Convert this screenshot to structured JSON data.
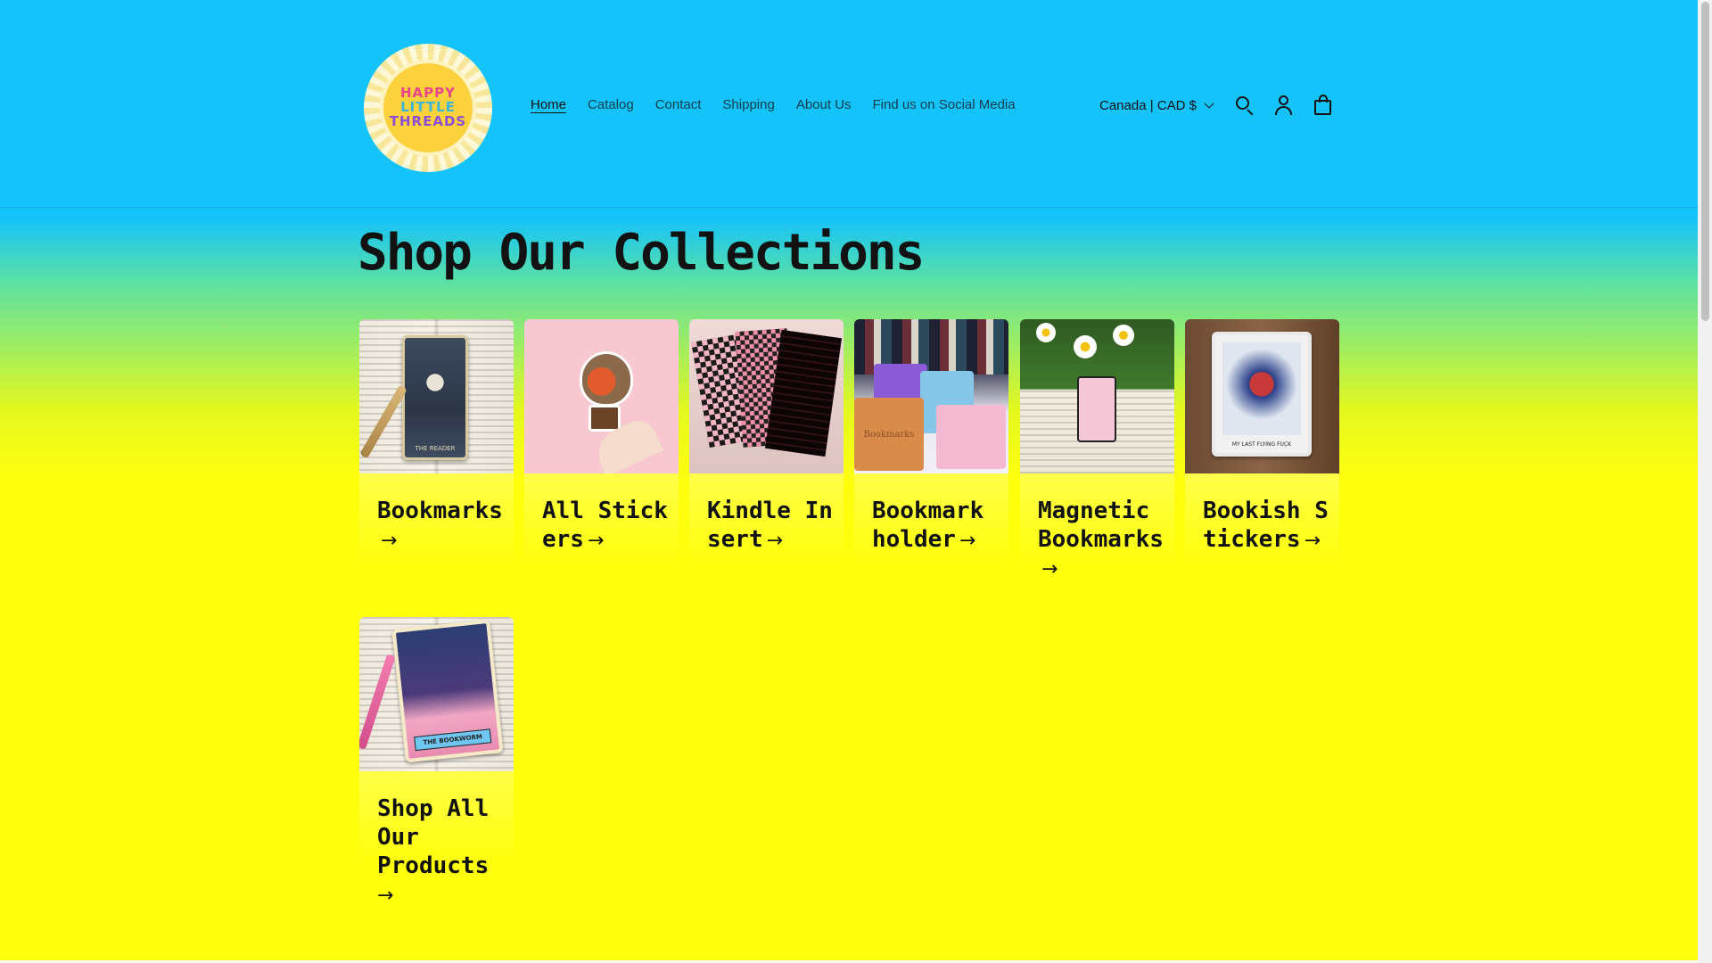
{
  "header": {
    "logo_text": [
      "HAPPY",
      "LITTLE",
      "THREADS"
    ],
    "nav": [
      {
        "label": "Home",
        "active": true
      },
      {
        "label": "Catalog",
        "active": false
      },
      {
        "label": "Contact",
        "active": false
      },
      {
        "label": "Shipping",
        "active": false
      },
      {
        "label": "About Us",
        "active": false
      },
      {
        "label": "Find us on Social Media",
        "active": false
      }
    ],
    "country_selector": "Canada | CAD $",
    "icons": [
      "search-icon",
      "account-icon",
      "cart-icon"
    ]
  },
  "main": {
    "title": "Shop Our Collections",
    "collections": [
      {
        "title": "Bookmarks",
        "arrow": "→"
      },
      {
        "title": "All Stickers",
        "arrow": "→"
      },
      {
        "title": "Kindle Insert",
        "arrow": "→"
      },
      {
        "title": "Bookmark holder",
        "arrow": "→"
      },
      {
        "title": "Magnetic Bookmarks",
        "arrow": "→"
      },
      {
        "title": "Bookish Stickers",
        "arrow": "→"
      },
      {
        "title": "Shop All Our Products",
        "arrow": "→"
      }
    ],
    "image_labels": {
      "bookmark_card": "THE READER",
      "shop_all_card": "THE BOOKWORM",
      "bookish_card": "MY LAST FLYING FUCK",
      "holder_label": "Bookmarks"
    }
  },
  "colors": {
    "header_bg": "#14c3f9",
    "body_bg_bottom": "#ffff0d",
    "text": "#121212"
  }
}
